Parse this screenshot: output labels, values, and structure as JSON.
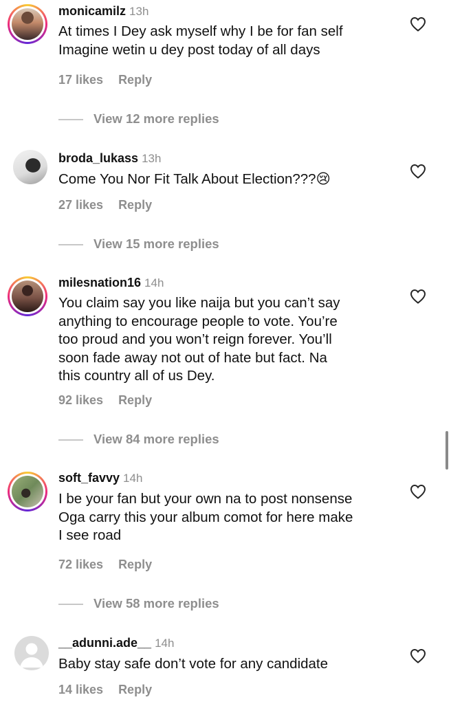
{
  "comments": [
    {
      "username": "monicamilz",
      "time": "13h",
      "lines": [
        "At times I Dey ask myself why I be for fan self",
        "Imagine wetin u dey post today of all days"
      ],
      "likes": "17 likes",
      "reply": "Reply",
      "view_replies": "View 12 more replies"
    },
    {
      "username": "broda_lukass",
      "time": "13h",
      "lines": [
        "Come You Nor Fit Talk About Election???😢"
      ],
      "likes": "27 likes",
      "reply": "Reply",
      "view_replies": "View 15 more replies"
    },
    {
      "username": "milesnation16",
      "time": "14h",
      "lines": [
        "You claim say you like naija but you can’t say",
        "anything to encourage people to vote. You’re",
        "too proud and you won’t reign forever. You’ll",
        "soon fade away not out of hate but fact.  Na",
        "this country all of us Dey."
      ],
      "likes": "92 likes",
      "reply": "Reply",
      "view_replies": "View 84 more replies"
    },
    {
      "username": "soft_favvy",
      "time": "14h",
      "lines": [
        "I be your fan but your own na to post nonsense",
        "Oga carry this your album comot for here make",
        "I see road"
      ],
      "likes": "72 likes",
      "reply": "Reply",
      "view_replies": "View 58 more replies"
    },
    {
      "username": "__adunni.ade__",
      "time": "14h",
      "lines": [
        "Baby stay safe don’t vote for any candidate"
      ],
      "likes": "14 likes",
      "reply": "Reply"
    }
  ],
  "icons": {
    "like": "heart-outline-icon",
    "avatar_placeholder": "default-avatar-icon"
  },
  "colors": {
    "secondary_text": "#8e8e8e",
    "story_ring": [
      "#f9ce34",
      "#ee2a7b",
      "#6228d7"
    ]
  }
}
